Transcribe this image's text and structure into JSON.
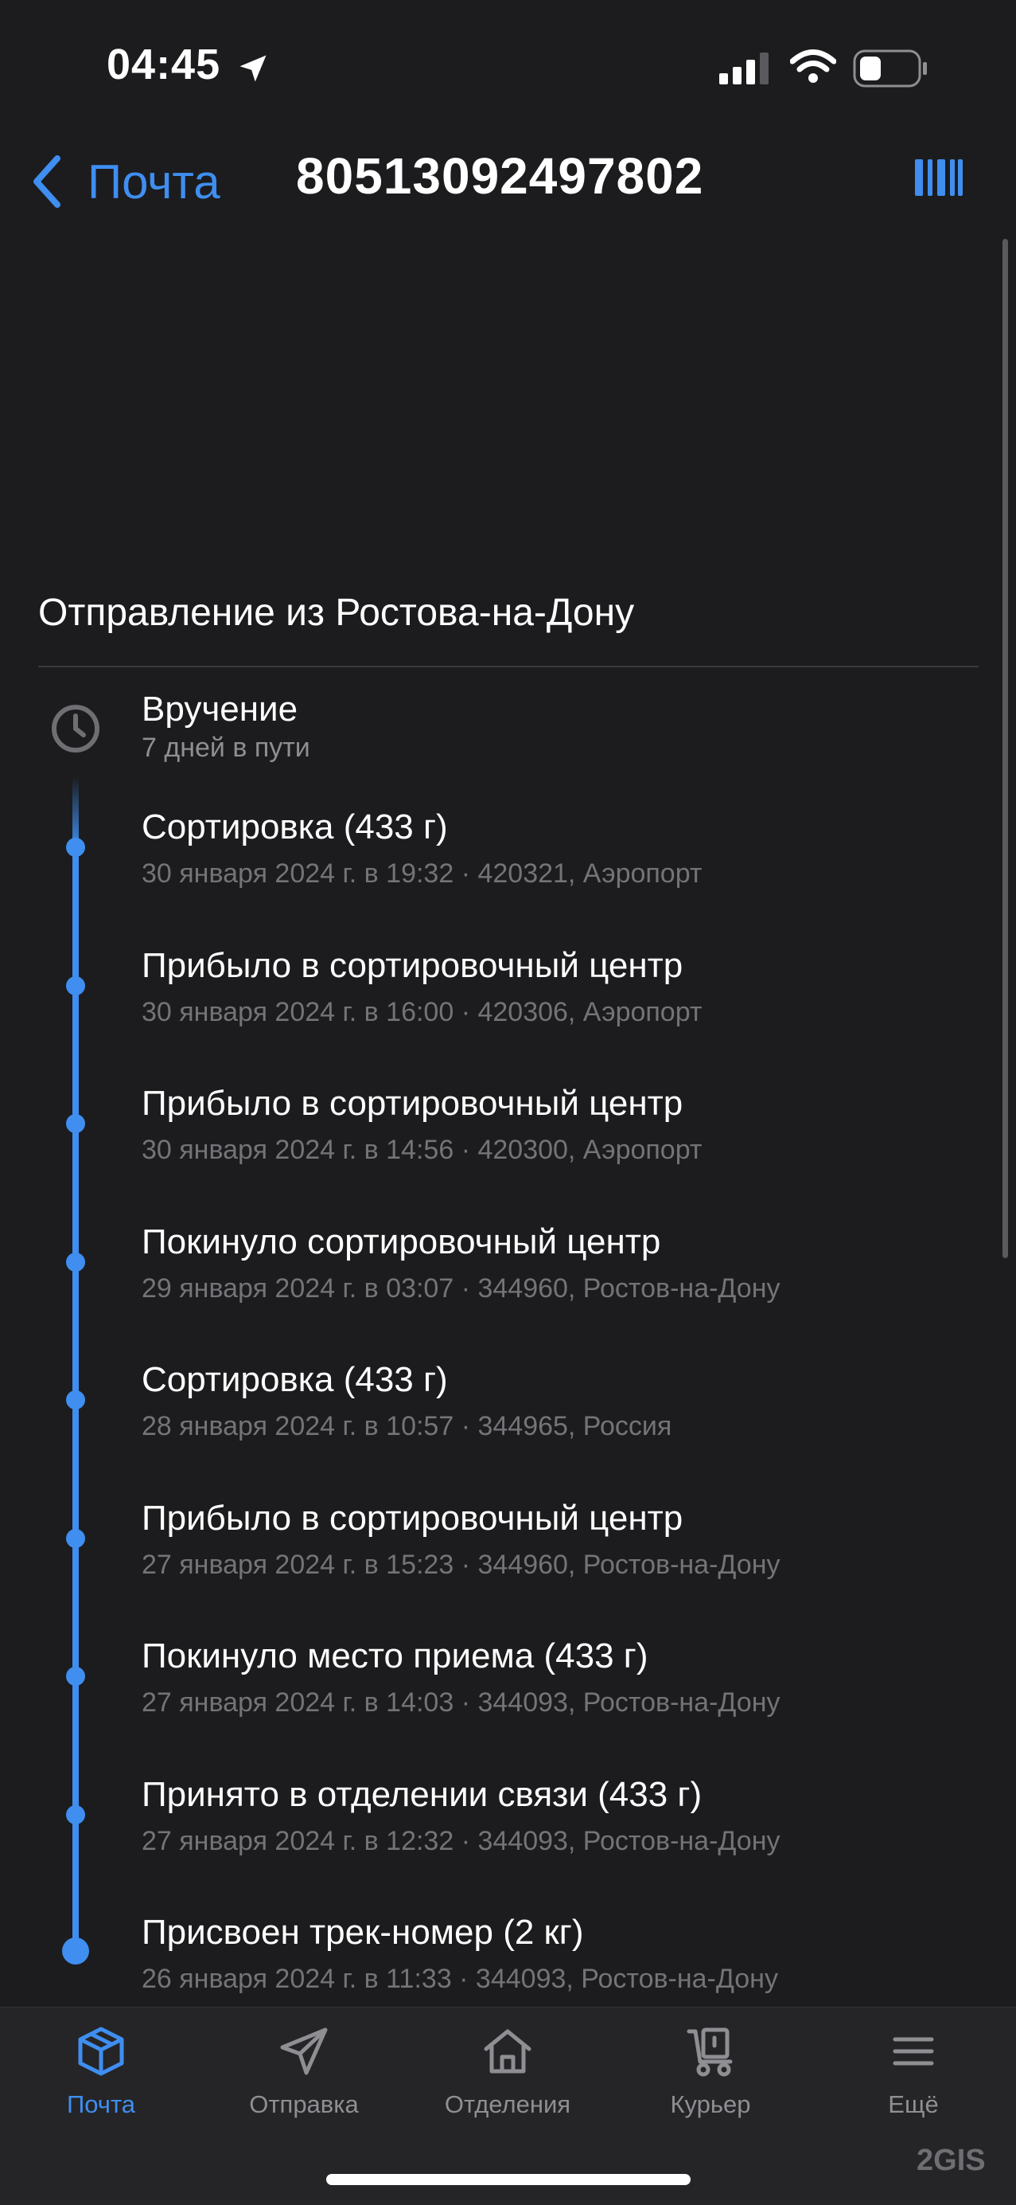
{
  "status": {
    "time": "04:45"
  },
  "nav": {
    "back_label": "Почта",
    "title": "80513092497802"
  },
  "section": {
    "title": "Отправление из Ростова-на-Дону"
  },
  "delivery": {
    "title": "Вручение",
    "subtitle": "7 дней в пути"
  },
  "events": [
    {
      "title": "Сортировка  (433 г)",
      "subtitle": "30 января 2024 г. в 19:32 · 420321, Аэропорт"
    },
    {
      "title": "Прибыло в сортировочный центр",
      "subtitle": "30 января 2024 г. в 16:00 · 420306, Аэропорт"
    },
    {
      "title": "Прибыло в сортировочный центр",
      "subtitle": "30 января 2024 г. в 14:56 · 420300, Аэропорт"
    },
    {
      "title": "Покинуло сортировочный центр",
      "subtitle": "29 января 2024 г. в 03:07 · 344960, Ростов-на-Дону"
    },
    {
      "title": "Сортировка  (433 г)",
      "subtitle": "28 января 2024 г. в 10:57 · 344965, Россия"
    },
    {
      "title": "Прибыло в сортировочный центр",
      "subtitle": "27 января 2024 г. в 15:23 · 344960, Ростов-на-Дону"
    },
    {
      "title": "Покинуло место приема  (433 г)",
      "subtitle": "27 января 2024 г. в 14:03 · 344093, Ростов-на-Дону"
    },
    {
      "title": "Принято в отделении связи  (433 г)",
      "subtitle": "27 января 2024 г. в 12:32 · 344093, Ростов-на-Дону"
    },
    {
      "title": "Присвоен трек-номер  (2 кг)",
      "subtitle": "26 января 2024 г. в 11:33 · 344093, Ростов-на-Дону"
    }
  ],
  "tabs": [
    {
      "label": "Почта",
      "icon": "box-icon",
      "active": true
    },
    {
      "label": "Отправка",
      "icon": "paper-plane-icon",
      "active": false
    },
    {
      "label": "Отделения",
      "icon": "house-icon",
      "active": false
    },
    {
      "label": "Курьер",
      "icon": "courier-cart-icon",
      "active": false
    },
    {
      "label": "Ещё",
      "icon": "menu-icon",
      "active": false
    }
  ],
  "watermark": "2GIS",
  "colors": {
    "accent": "#3f8ef0",
    "background": "#1c1c1e",
    "secondary_text": "#737378",
    "tab_bar": "#252527"
  }
}
